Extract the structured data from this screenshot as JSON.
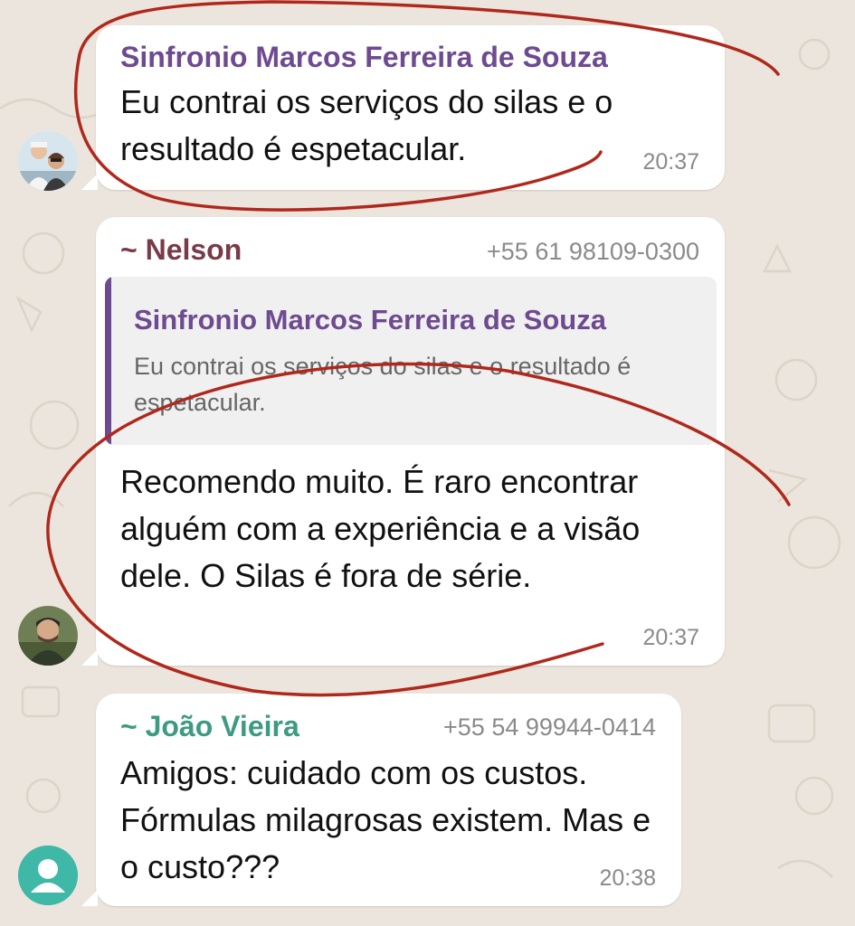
{
  "colors": {
    "background": "#ece5dd",
    "bubble": "#ffffff",
    "sender_sinfronio": "#6e4a91",
    "sender_nelson": "#7a3b48",
    "sender_joao": "#3e9a82",
    "quote_bar": "#6e4a91",
    "annotation_ink": "#b0281c",
    "default_avatar": "#40b8a8"
  },
  "messages": [
    {
      "sender": "Sinfronio Marcos Ferreira de Souza",
      "text": "Eu contrai os serviços do silas e o resultado é espetacular.",
      "time": "20:37",
      "avatar": "couple-photo-avatar"
    },
    {
      "sender": "~ Nelson",
      "phone": "+55 61 98109-0300",
      "quote": {
        "sender": "Sinfronio Marcos Ferreira de Souza",
        "text": "Eu contrai os serviços do silas e o resultado é espetacular."
      },
      "text": "Recomendo muito. É raro encontrar alguém com a experiência e a visão dele. O Silas é fora de série.",
      "time": "20:37",
      "avatar": "man-photo-avatar"
    },
    {
      "sender": "~ João Vieira",
      "phone": "+55 54 99944-0414",
      "text": "Amigos: cuidado com os custos. Fórmulas milagrosas existem. Mas e o custo???",
      "time": "20:38",
      "avatar": "default-person-icon"
    }
  ]
}
